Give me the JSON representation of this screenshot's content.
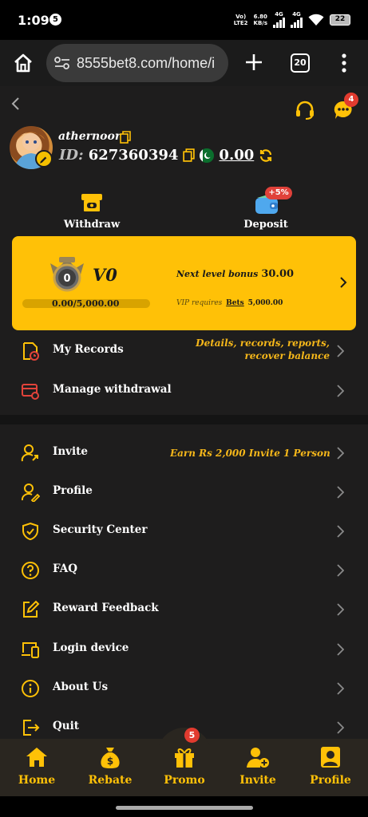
{
  "status": {
    "time": "1:09",
    "notif_count": "5",
    "net_label_1": "Vo)",
    "net_label_2": "LTE2",
    "speed": "6.80",
    "speed_unit": "KB/s",
    "net_4g_a": "4G",
    "net_4g_b": "4G",
    "battery": "22"
  },
  "browser": {
    "url": "8555bet8.com/home/i",
    "tab_count": "20"
  },
  "header": {
    "chat_badge": "4"
  },
  "user": {
    "name": "athernoor",
    "id_label": "ID:",
    "id": "627360394",
    "balance": "0.00"
  },
  "actions": {
    "withdraw": "Withdraw",
    "deposit": "Deposit",
    "deposit_badge": "+5%"
  },
  "vip": {
    "level": "V0",
    "progress_text": "0.00/5,000.00",
    "progress": 0,
    "medal_num": "0",
    "next_label": "Next level bonus",
    "next_value": "30.00",
    "req_prefix": "VIP requires",
    "req_link": "Bets",
    "req_value": "5,000.00"
  },
  "menu_top": [
    {
      "label": "My Records",
      "extra_1": "Details, records, reports,",
      "extra_2": "recover balance"
    },
    {
      "label": "Manage withdrawal"
    }
  ],
  "menu": [
    {
      "label": "Invite",
      "extra": "Earn Rs 2,000  Invite 1 Person"
    },
    {
      "label": "Profile"
    },
    {
      "label": "Security Center"
    },
    {
      "label": "FAQ"
    },
    {
      "label": "Reward Feedback"
    },
    {
      "label": "Login device"
    },
    {
      "label": "About Us"
    },
    {
      "label": "Quit"
    }
  ],
  "nav": {
    "home": "Home",
    "rebate": "Rebate",
    "promo": "Promo",
    "promo_badge": "5",
    "invite": "Invite",
    "profile": "Profile"
  },
  "colors": {
    "accent": "#ffc107",
    "background": "#1e1d1d",
    "badge": "#e23b2f",
    "text_accent": "#f5b71a"
  }
}
